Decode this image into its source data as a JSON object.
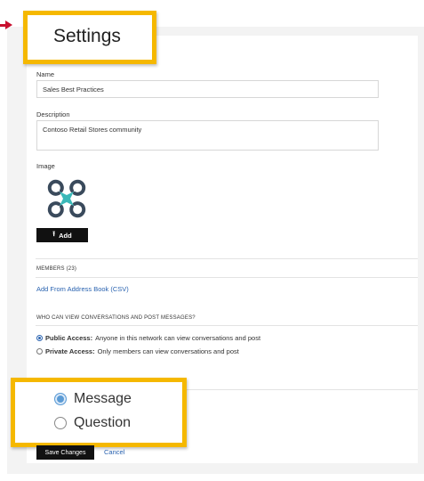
{
  "header": {
    "title": "Settings"
  },
  "form": {
    "name_label": "Name",
    "name_value": "Sales Best Practices",
    "description_label": "Description",
    "description_value": "Contoso Retail Stores community",
    "image_label": "Image",
    "add_label": "Add",
    "add_icon": "upload-icon",
    "image_icon": "drone-logo-icon"
  },
  "members": {
    "heading": "MEMBERS (23)",
    "link": "Add From Address Book (CSV)"
  },
  "access": {
    "heading": "WHO CAN VIEW CONVERSATIONS AND POST MESSAGES?",
    "options": [
      {
        "title": "Public Access:",
        "desc": "Anyone in this network can view conversations and post",
        "selected": true
      },
      {
        "title": "Private Access:",
        "desc": "Only members can view conversations and post",
        "selected": false
      }
    ]
  },
  "post_type": {
    "options": [
      {
        "label": "Message",
        "selected": true
      },
      {
        "label": "Question",
        "selected": false
      }
    ]
  },
  "actions": {
    "save": "Save Changes",
    "cancel": "Cancel"
  },
  "colors": {
    "highlight": "#f5b800",
    "arrow": "#c8102e",
    "link": "#2a63b0",
    "drone_body": "#3a4a5c",
    "drone_center": "#3ab8b8"
  }
}
